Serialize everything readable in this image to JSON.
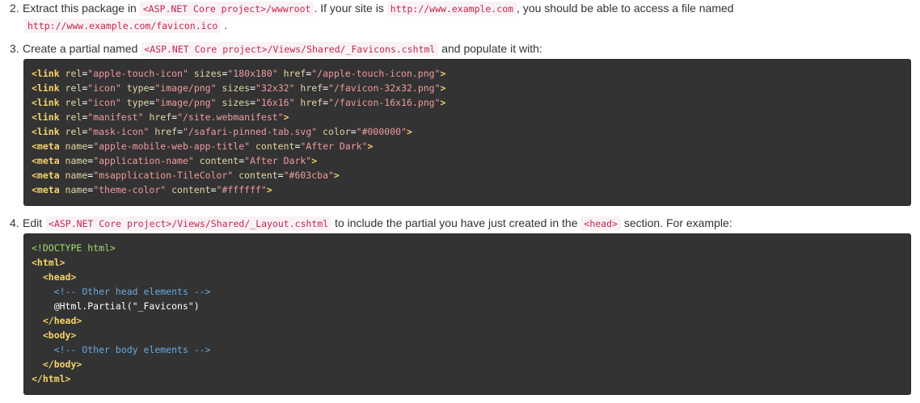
{
  "step2": {
    "number": "2.",
    "text1": "Extract this package in",
    "code1": "<ASP.NET Core project>/wwwroot",
    "text2": ". If your site is",
    "code2": "http://www.example.com",
    "text3": ", you should be able to access a file named",
    "code3": "http://www.example.com/favicon.ico",
    "text4": "."
  },
  "step3": {
    "number": "3.",
    "text1": "Create a partial named",
    "code1": "<ASP.NET Core project>/Views/Shared/_Favicons.cshtml",
    "text2": "and populate it with:"
  },
  "block1": [
    [
      {
        "t": "<link ",
        "c": "tg"
      },
      {
        "t": "rel",
        "c": "an"
      },
      {
        "t": "=",
        "c": "tx"
      },
      {
        "t": "\"apple-touch-icon\"",
        "c": "av"
      },
      {
        "t": " sizes",
        "c": "an"
      },
      {
        "t": "=",
        "c": "tx"
      },
      {
        "t": "\"180x180\"",
        "c": "av"
      },
      {
        "t": " href",
        "c": "an"
      },
      {
        "t": "=",
        "c": "tx"
      },
      {
        "t": "\"/apple-touch-icon.png\"",
        "c": "av"
      },
      {
        "t": ">",
        "c": "tg"
      }
    ],
    [
      {
        "t": "<link ",
        "c": "tg"
      },
      {
        "t": "rel",
        "c": "an"
      },
      {
        "t": "=",
        "c": "tx"
      },
      {
        "t": "\"icon\"",
        "c": "av"
      },
      {
        "t": " type",
        "c": "an"
      },
      {
        "t": "=",
        "c": "tx"
      },
      {
        "t": "\"image/png\"",
        "c": "av"
      },
      {
        "t": " sizes",
        "c": "an"
      },
      {
        "t": "=",
        "c": "tx"
      },
      {
        "t": "\"32x32\"",
        "c": "av"
      },
      {
        "t": " href",
        "c": "an"
      },
      {
        "t": "=",
        "c": "tx"
      },
      {
        "t": "\"/favicon-32x32.png\"",
        "c": "av"
      },
      {
        "t": ">",
        "c": "tg"
      }
    ],
    [
      {
        "t": "<link ",
        "c": "tg"
      },
      {
        "t": "rel",
        "c": "an"
      },
      {
        "t": "=",
        "c": "tx"
      },
      {
        "t": "\"icon\"",
        "c": "av"
      },
      {
        "t": " type",
        "c": "an"
      },
      {
        "t": "=",
        "c": "tx"
      },
      {
        "t": "\"image/png\"",
        "c": "av"
      },
      {
        "t": " sizes",
        "c": "an"
      },
      {
        "t": "=",
        "c": "tx"
      },
      {
        "t": "\"16x16\"",
        "c": "av"
      },
      {
        "t": " href",
        "c": "an"
      },
      {
        "t": "=",
        "c": "tx"
      },
      {
        "t": "\"/favicon-16x16.png\"",
        "c": "av"
      },
      {
        "t": ">",
        "c": "tg"
      }
    ],
    [
      {
        "t": "<link ",
        "c": "tg"
      },
      {
        "t": "rel",
        "c": "an"
      },
      {
        "t": "=",
        "c": "tx"
      },
      {
        "t": "\"manifest\"",
        "c": "av"
      },
      {
        "t": " href",
        "c": "an"
      },
      {
        "t": "=",
        "c": "tx"
      },
      {
        "t": "\"/site.webmanifest\"",
        "c": "av"
      },
      {
        "t": ">",
        "c": "tg"
      }
    ],
    [
      {
        "t": "<link ",
        "c": "tg"
      },
      {
        "t": "rel",
        "c": "an"
      },
      {
        "t": "=",
        "c": "tx"
      },
      {
        "t": "\"mask-icon\"",
        "c": "av"
      },
      {
        "t": " href",
        "c": "an"
      },
      {
        "t": "=",
        "c": "tx"
      },
      {
        "t": "\"/safari-pinned-tab.svg\"",
        "c": "av"
      },
      {
        "t": " color",
        "c": "an"
      },
      {
        "t": "=",
        "c": "tx"
      },
      {
        "t": "\"#000000\"",
        "c": "av"
      },
      {
        "t": ">",
        "c": "tg"
      }
    ],
    [
      {
        "t": "<meta ",
        "c": "tg"
      },
      {
        "t": "name",
        "c": "an"
      },
      {
        "t": "=",
        "c": "tx"
      },
      {
        "t": "\"apple-mobile-web-app-title\"",
        "c": "av"
      },
      {
        "t": " content",
        "c": "an"
      },
      {
        "t": "=",
        "c": "tx"
      },
      {
        "t": "\"After Dark\"",
        "c": "av"
      },
      {
        "t": ">",
        "c": "tg"
      }
    ],
    [
      {
        "t": "<meta ",
        "c": "tg"
      },
      {
        "t": "name",
        "c": "an"
      },
      {
        "t": "=",
        "c": "tx"
      },
      {
        "t": "\"application-name\"",
        "c": "av"
      },
      {
        "t": " content",
        "c": "an"
      },
      {
        "t": "=",
        "c": "tx"
      },
      {
        "t": "\"After Dark\"",
        "c": "av"
      },
      {
        "t": ">",
        "c": "tg"
      }
    ],
    [
      {
        "t": "<meta ",
        "c": "tg"
      },
      {
        "t": "name",
        "c": "an"
      },
      {
        "t": "=",
        "c": "tx"
      },
      {
        "t": "\"msapplication-TileColor\"",
        "c": "av"
      },
      {
        "t": " content",
        "c": "an"
      },
      {
        "t": "=",
        "c": "tx"
      },
      {
        "t": "\"#603cba\"",
        "c": "av"
      },
      {
        "t": ">",
        "c": "tg"
      }
    ],
    [
      {
        "t": "<meta ",
        "c": "tg"
      },
      {
        "t": "name",
        "c": "an"
      },
      {
        "t": "=",
        "c": "tx"
      },
      {
        "t": "\"theme-color\"",
        "c": "av"
      },
      {
        "t": " content",
        "c": "an"
      },
      {
        "t": "=",
        "c": "tx"
      },
      {
        "t": "\"#ffffff\"",
        "c": "av"
      },
      {
        "t": ">",
        "c": "tg"
      }
    ]
  ],
  "step4": {
    "number": "4.",
    "text1": "Edit",
    "code1": "<ASP.NET Core project>/Views/Shared/_Layout.cshtml",
    "text2": "to include the partial you have just created in the",
    "code2": "<head>",
    "text3": "section. For example:"
  },
  "block2": [
    [
      {
        "t": "<!DOCTYPE html>",
        "c": "dt"
      }
    ],
    [
      {
        "t": "<html>",
        "c": "tg"
      }
    ],
    [
      {
        "t": "  ",
        "c": "tx"
      },
      {
        "t": "<head>",
        "c": "tg"
      }
    ],
    [
      {
        "t": "    ",
        "c": "tx"
      },
      {
        "t": "<!-- Other head elements -->",
        "c": "cm"
      }
    ],
    [
      {
        "t": "    @Html.Partial(\"_Favicons\")",
        "c": "tx"
      }
    ],
    [
      {
        "t": "  ",
        "c": "tx"
      },
      {
        "t": "</head>",
        "c": "tg"
      }
    ],
    [
      {
        "t": "  ",
        "c": "tx"
      },
      {
        "t": "<body>",
        "c": "tg"
      }
    ],
    [
      {
        "t": "    ",
        "c": "tx"
      },
      {
        "t": "<!-- Other body elements -->",
        "c": "cm"
      }
    ],
    [
      {
        "t": "  ",
        "c": "tx"
      },
      {
        "t": "</body>",
        "c": "tg"
      }
    ],
    [
      {
        "t": "</html>",
        "c": "tg"
      }
    ]
  ],
  "colors": {
    "code_bg": "#333333",
    "inline_code_fg": "#c7254e",
    "inline_code_bg": "#f9f2f4",
    "tag": "#f6d36a",
    "attr_name": "#e1d7a4",
    "attr_value": "#f19aa0",
    "comment": "#69a9e0",
    "doctype": "#9be16b"
  }
}
